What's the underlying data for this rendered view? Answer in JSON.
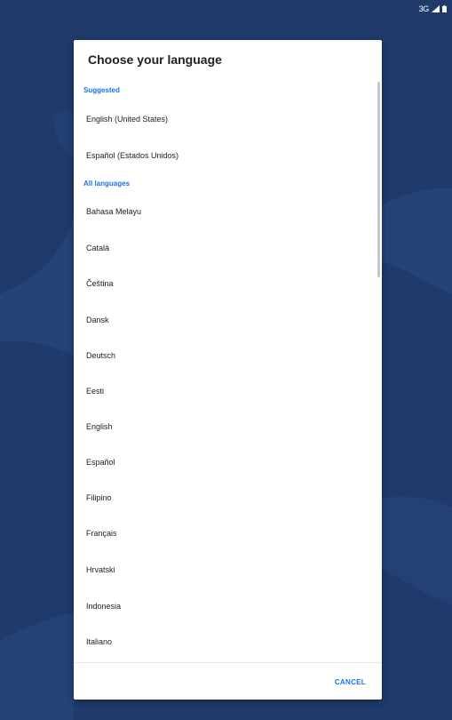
{
  "status_bar": {
    "network": "3G",
    "icons": [
      "signal-icon",
      "battery-icon"
    ]
  },
  "dialog": {
    "title": "Choose your language",
    "suggested_header": "Suggested",
    "suggested": [
      "English (United States)",
      "Español (Estados Unidos)"
    ],
    "all_header": "All languages",
    "languages": [
      "Bahasa Melayu",
      "Català",
      "Čeština",
      "Dansk",
      "Deutsch",
      "Eesti",
      "English",
      "Español",
      "Filipino",
      "Français",
      "Hrvatski",
      "Indonesia",
      "Italiano"
    ],
    "cancel_label": "CANCEL"
  },
  "colors": {
    "background": "#1f3a6b",
    "accent": "#1a73e8",
    "text": "#202124"
  }
}
